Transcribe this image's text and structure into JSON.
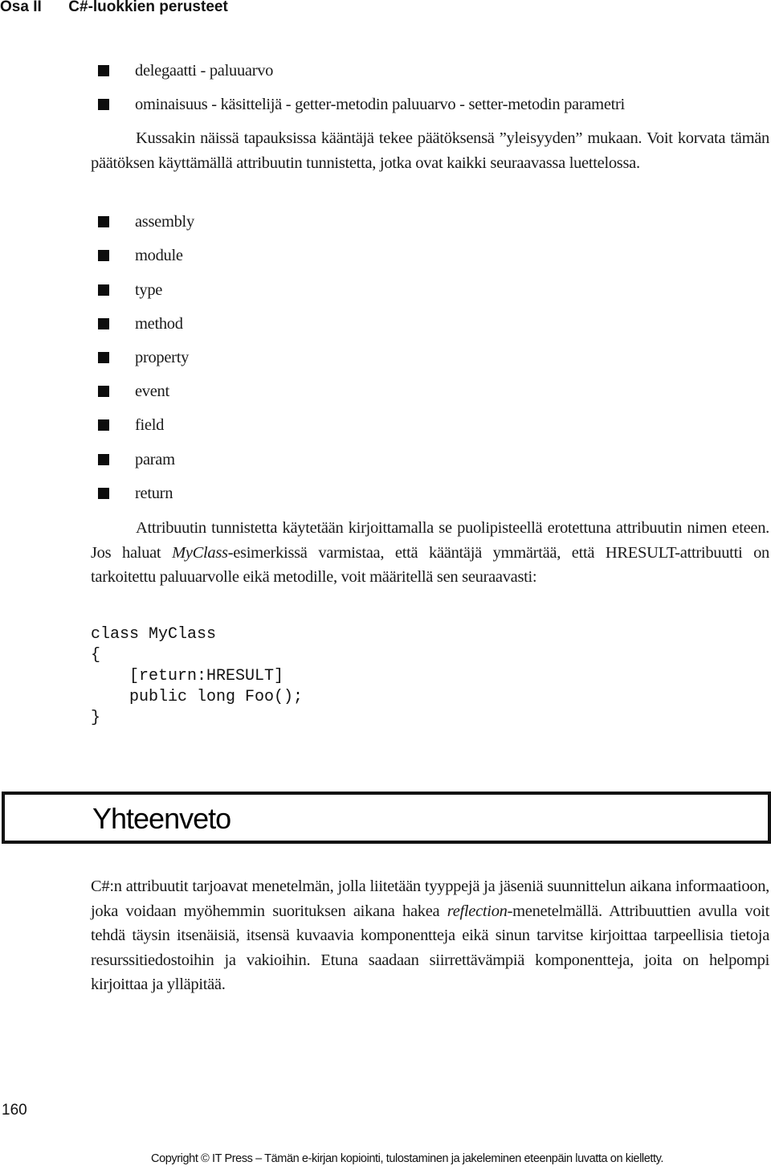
{
  "header": {
    "part": "Osa II",
    "chapter": "C#-luokkien perusteet"
  },
  "bullets_top": [
    "delegaatti - paluuarvo",
    "ominaisuus - käsittelijä - getter-metodin paluuarvo - setter-metodin parametri"
  ],
  "para1": "Kussakin näissä tapauksissa kääntäjä tekee päätöksensä ”yleisyyden” mukaan. Voit korvata tämän päätöksen käyttämällä attribuutin tunnistetta, jotka ovat kaikki seuraavassa luettelossa.",
  "targets": [
    "assembly",
    "module",
    "type",
    "method",
    "property",
    "event",
    "field",
    "param",
    "return"
  ],
  "para2": {
    "before": "Attribuutin tunnistetta käytetään kirjoittamalla se puolipisteellä erotettuna attribuutin nimen eteen. Jos haluat ",
    "italic": "MyClass",
    "after": "-esimerkissä varmistaa, että kääntäjä ymmärtää, että HRESULT-attribuutti on tarkoitettu paluuarvolle eikä metodille, voit määritellä sen seuraavasti:"
  },
  "code": "class MyClass\n{\n    [return:HRESULT]\n    public long Foo();\n}",
  "section": {
    "title": "Yhteenveto"
  },
  "summary": {
    "before": "C#:n attribuutit tarjoavat menetelmän, jolla liitetään tyyppejä ja jäseniä suunnittelun aikana informaatioon, joka voidaan myöhemmin suorituksen aikana hakea ",
    "italic": "reflection",
    "after": "-menetelmällä. Attribuuttien avulla voit tehdä täysin itsenäisiä, itsensä kuvaavia komponentteja eikä sinun tarvitse kirjoittaa tarpeellisia tietoja resurssitiedostoihin ja vakioihin. Etuna saadaan siirrettävämpiä komponentteja, joita on helpompi kirjoittaa ja ylläpitää."
  },
  "footer": {
    "page_number": "160",
    "copyright": "Copyright © IT Press – Tämän e-kirjan kopiointi, tulostaminen ja jakeleminen eteenpäin luvatta on kielletty."
  }
}
